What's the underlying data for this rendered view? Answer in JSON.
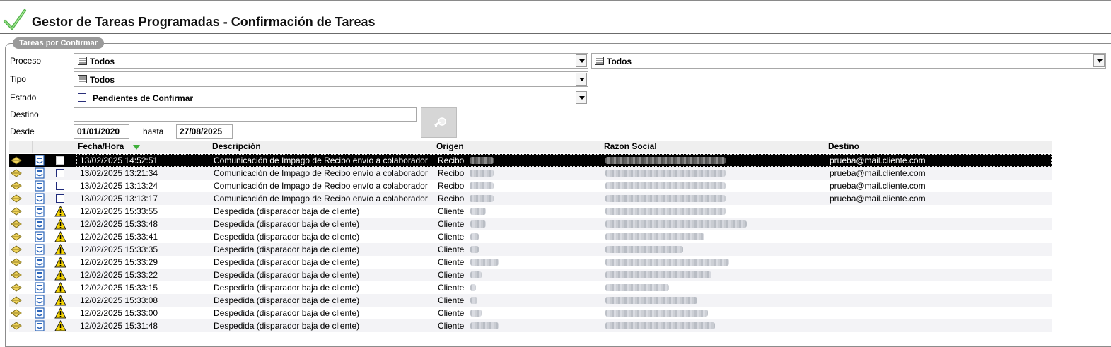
{
  "app": {
    "title": "Gestor de Tareas Programadas - Confirmación de Tareas",
    "group_label": "Tareas por Confirmar"
  },
  "filters": {
    "proceso_label": "Proceso",
    "proceso_value": "Todos",
    "proceso2_value": "Todos",
    "tipo_label": "Tipo",
    "tipo_value": "Todos",
    "estado_label": "Estado",
    "estado_value": "Pendientes de Confirmar",
    "destino_label": "Destino",
    "destino_value": "",
    "desde_label": "Desde",
    "desde_value": "01/01/2020",
    "hasta_label": "hasta",
    "hasta_value": "27/08/2025"
  },
  "grid": {
    "columns": {
      "fecha": "Fecha/Hora",
      "descripcion": "Descripción",
      "origen": "Origen",
      "razon": "Razon Social",
      "destino": "Destino"
    },
    "rows": [
      {
        "fecha": "13/02/2025 14:52:51",
        "descripcion": "Comunicación de Impago de Recibo envío a colaborador",
        "origen": "Recibo",
        "destino": "prueba@mail.cliente.com",
        "kind": "checkbox",
        "selected": true
      },
      {
        "fecha": "13/02/2025 13:21:34",
        "descripcion": "Comunicación de Impago de Recibo envío a colaborador",
        "origen": "Recibo",
        "destino": "prueba@mail.cliente.com",
        "kind": "checkbox",
        "selected": false
      },
      {
        "fecha": "13/02/2025 13:13:24",
        "descripcion": "Comunicación de Impago de Recibo envío a colaborador",
        "origen": "Recibo",
        "destino": "prueba@mail.cliente.com",
        "kind": "checkbox",
        "selected": false
      },
      {
        "fecha": "13/02/2025 13:13:17",
        "descripcion": "Comunicación de Impago de Recibo envío a colaborador",
        "origen": "Recibo",
        "destino": "prueba@mail.cliente.com",
        "kind": "checkbox",
        "selected": false
      },
      {
        "fecha": "12/02/2025 15:33:55",
        "descripcion": "Despedida (disparador baja de cliente)",
        "origen": "Cliente",
        "destino": "",
        "kind": "warning",
        "selected": false
      },
      {
        "fecha": "12/02/2025 15:33:48",
        "descripcion": "Despedida (disparador baja de cliente)",
        "origen": "Cliente",
        "destino": "",
        "kind": "warning",
        "selected": false
      },
      {
        "fecha": "12/02/2025 15:33:41",
        "descripcion": "Despedida (disparador baja de cliente)",
        "origen": "Cliente",
        "destino": "",
        "kind": "warning",
        "selected": false
      },
      {
        "fecha": "12/02/2025 15:33:35",
        "descripcion": "Despedida (disparador baja de cliente)",
        "origen": "Cliente",
        "destino": "",
        "kind": "warning",
        "selected": false
      },
      {
        "fecha": "12/02/2025 15:33:29",
        "descripcion": "Despedida (disparador baja de cliente)",
        "origen": "Cliente",
        "destino": "",
        "kind": "warning",
        "selected": false
      },
      {
        "fecha": "12/02/2025 15:33:22",
        "descripcion": "Despedida (disparador baja de cliente)",
        "origen": "Cliente",
        "destino": "",
        "kind": "warning",
        "selected": false
      },
      {
        "fecha": "12/02/2025 15:33:15",
        "descripcion": "Despedida (disparador baja de cliente)",
        "origen": "Cliente",
        "destino": "",
        "kind": "warning",
        "selected": false
      },
      {
        "fecha": "12/02/2025 15:33:08",
        "descripcion": "Despedida (disparador baja de cliente)",
        "origen": "Cliente",
        "destino": "",
        "kind": "warning",
        "selected": false
      },
      {
        "fecha": "12/02/2025 15:33:00",
        "descripcion": "Despedida (disparador baja de cliente)",
        "origen": "Cliente",
        "destino": "",
        "kind": "warning",
        "selected": false
      },
      {
        "fecha": "12/02/2025 15:31:48",
        "descripcion": "Despedida (disparador baja de cliente)",
        "origen": "Cliente",
        "destino": "",
        "kind": "warning",
        "selected": false
      }
    ]
  },
  "icons": {
    "title": "checkmark-icon",
    "select": "list-icon",
    "search_button": "key-icon",
    "row_col1": "envelope-icon",
    "row_col2": "document-icon",
    "row_col3_a": "checkbox",
    "row_col3_b": "warning-icon"
  },
  "colors": {
    "selected_row": "#000000",
    "alt_row": "#f3f3f6",
    "check": "#3fae3a",
    "warning": "#f5d400"
  }
}
